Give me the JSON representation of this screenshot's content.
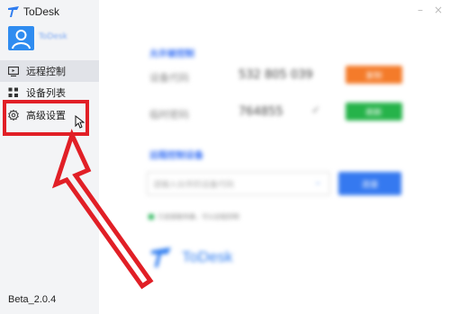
{
  "app": {
    "title": "ToDesk",
    "version": "Beta_2.0.4",
    "username": "ToDesk"
  },
  "window": {
    "minimize": "–",
    "close": "×"
  },
  "sidebar": {
    "items": [
      {
        "label": "远程控制",
        "icon": "monitor-icon"
      },
      {
        "label": "设备列表",
        "icon": "grid-icon"
      },
      {
        "label": "高级设置",
        "icon": "gear-icon"
      }
    ]
  },
  "main": {
    "allow_title": "允许被控制",
    "device_label": "设备代码",
    "device_code": "532 805 039",
    "password_label": "临时密码",
    "password": "764855",
    "copy_button": "复制",
    "refresh_button": "刷新",
    "control_title": "远程控制设备",
    "input_placeholder": "请输入伙伴的设备代码",
    "connect_button": "连接",
    "status_text": "已连接服务器，可以远程控制",
    "brand": "ToDesk"
  },
  "colors": {
    "accent": "#2f7df0",
    "orange": "#f47b2a",
    "green": "#26b34a",
    "highlight": "#e11f26"
  }
}
